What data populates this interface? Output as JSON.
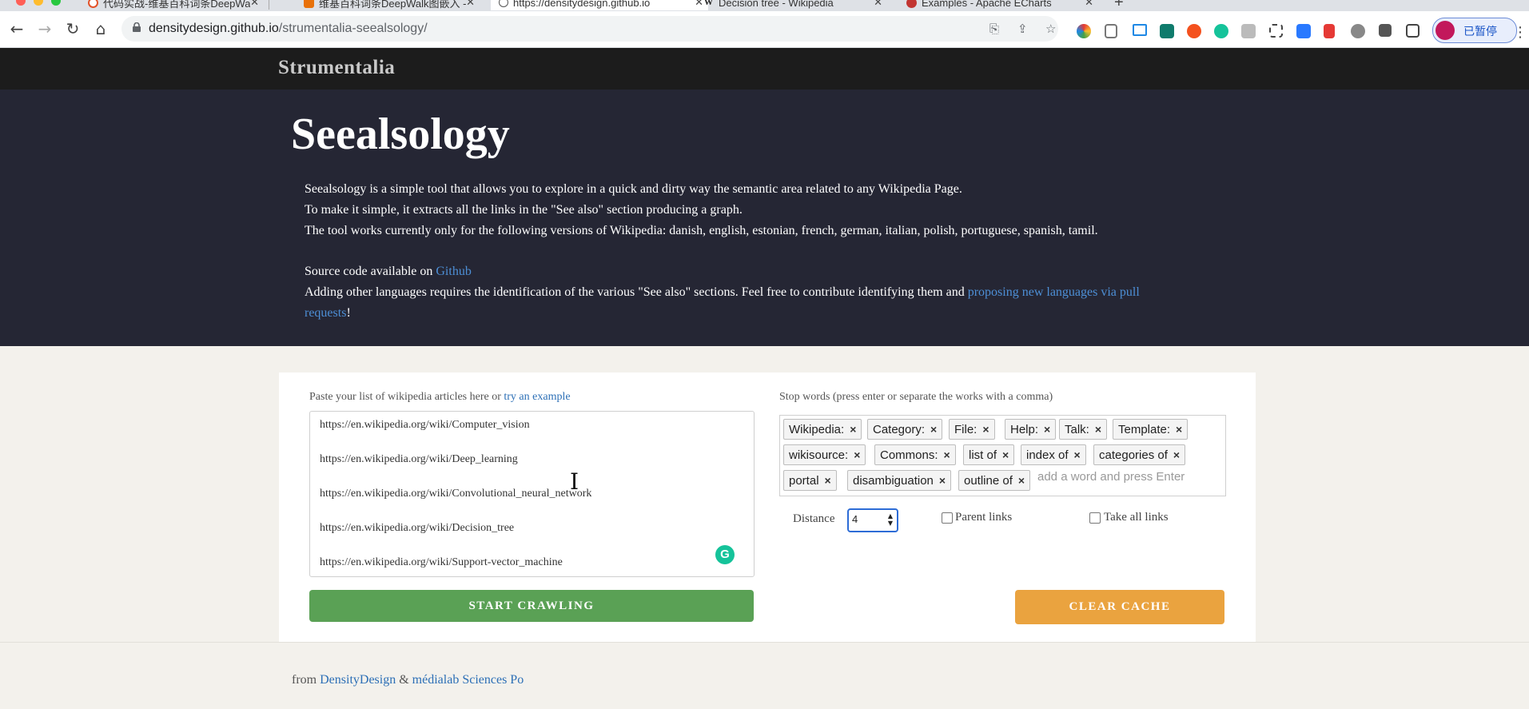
{
  "browser": {
    "tabs": [
      {
        "title": "代码实战-维基百科词条DeepWa",
        "active": false
      },
      {
        "title": "维基百科词条DeepWalk图嵌入 -",
        "active": false
      },
      {
        "title": "https://densitydesign.github.io",
        "active": true
      },
      {
        "title": "Decision tree - Wikipedia",
        "active": false
      },
      {
        "title": "Examples - Apache ECharts",
        "active": false
      }
    ],
    "url_host": "densitydesign.github.io",
    "url_path": "/strumentalia-seealsology/",
    "profile_label": "已暂停"
  },
  "site": {
    "brand": "Strumentalia"
  },
  "hero": {
    "title": "Seealsology",
    "line1": "Seealsology is a simple tool that allows you to explore in a quick and dirty way the semantic area related to any Wikipedia Page.",
    "line2": "To make it simple, it extracts all the links in the \"See also\" section producing a graph.",
    "line3": "The tool works currently only for the following versions of Wikipedia: danish, english, estonian, french, german, italian, polish, portuguese, spanish, tamil.",
    "source_prefix": "Source code available on ",
    "source_link": "Github",
    "contrib_text": "Adding other languages requires the identification of the various \"See also\" sections. Feel free to contribute identifying them and ",
    "contrib_link_1": "proposing new languages via pull",
    "contrib_link_2": "requests",
    "contrib_end": "!"
  },
  "input": {
    "label": "Paste your list of wikipedia articles here or ",
    "example_link": "try an example",
    "urls": [
      "https://en.wikipedia.org/wiki/Computer_vision",
      "https://en.wikipedia.org/wiki/Deep_learning",
      "https://en.wikipedia.org/wiki/Convolutional_neural_network",
      "https://en.wikipedia.org/wiki/Decision_tree",
      "https://en.wikipedia.org/wiki/Support-vector_machine"
    ],
    "grammarly_label": "G"
  },
  "stopwords": {
    "label": "Stop words (press enter or separate the works with a comma)",
    "tags": [
      "Wikipedia:",
      "Category:",
      "File:",
      "Help:",
      "Talk:",
      "Template:",
      "wikisource:",
      "Commons:",
      "list of",
      "index of",
      "categories of",
      "portal",
      "disambiguation",
      "outline of"
    ],
    "placeholder": "add a word and press Enter",
    "remove_glyph": "×"
  },
  "options": {
    "distance_label": "Distance",
    "distance_value": "4",
    "parent_links_label": "Parent links",
    "parent_links_checked": false,
    "take_all_label": "Take all links",
    "take_all_checked": false
  },
  "buttons": {
    "start": "START CRAWLING",
    "clear": "CLEAR CACHE"
  },
  "footer": {
    "prefix": "from ",
    "link1": "DensityDesign",
    "amp": " & ",
    "link2": "médialab Sciences Po"
  },
  "colors": {
    "hero_bg": "#252634",
    "start_btn": "#5aa155",
    "clear_btn": "#eaa33f",
    "link": "#2c6fb6"
  }
}
